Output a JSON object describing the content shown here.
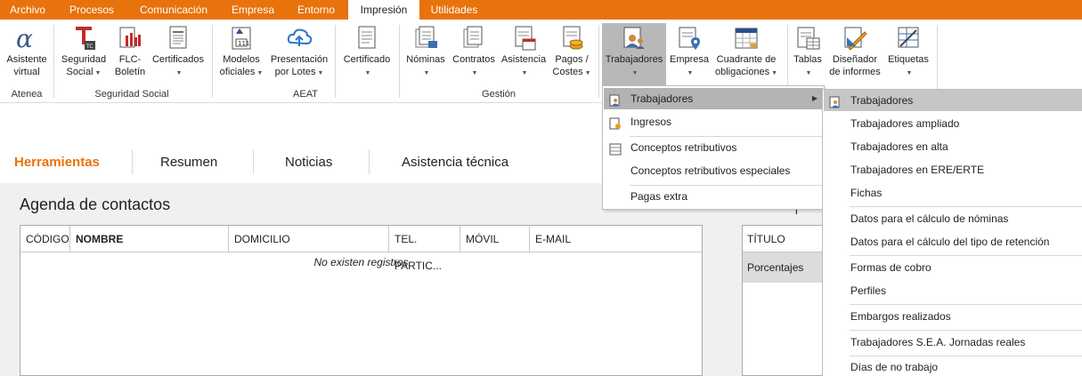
{
  "menu_tabs": [
    "Archivo",
    "Procesos",
    "Comunicación",
    "Empresa",
    "Entorno",
    "Impresión",
    "Utilidades"
  ],
  "active_tab": "Impresión",
  "ribbon": {
    "asistente": {
      "line1": "Asistente",
      "line2": "virtual"
    },
    "seguridad_social": {
      "line1": "Seguridad",
      "line2": "Social"
    },
    "flc": {
      "line1": "FLC-",
      "line2": "Boletín"
    },
    "certificados": {
      "line1": "Certificados"
    },
    "modelos": {
      "line1": "Modelos",
      "line2": "oficiales"
    },
    "presentacion": {
      "line1": "Presentación",
      "line2": "por Lotes"
    },
    "certificado": {
      "line1": "Certificado"
    },
    "nominas": {
      "line1": "Nóminas"
    },
    "contratos": {
      "line1": "Contratos"
    },
    "asistencia": {
      "line1": "Asistencia"
    },
    "pagos": {
      "line1": "Pagos /",
      "line2": "Costes"
    },
    "trabajadores": {
      "line1": "Trabajadores"
    },
    "empresa": {
      "line1": "Empresa"
    },
    "cuadrante": {
      "line1": "Cuadrante de",
      "line2": "obligaciones"
    },
    "tablas": {
      "line1": "Tablas"
    },
    "disenador": {
      "line1": "Diseñador",
      "line2": "de informes"
    },
    "etiquetas": {
      "line1": "Etiquetas"
    },
    "groups": {
      "atenea": "Atenea",
      "seguridad_social": "Seguridad Social",
      "aeat": "AEAT",
      "gestion": "Gestión"
    }
  },
  "subtabs": [
    "Herramientas",
    "Resumen",
    "Noticias",
    "Asistencia técnica"
  ],
  "agenda": {
    "title": "Agenda de contactos",
    "columns": [
      "CÓDIGO",
      "NOMBRE",
      "DOMICILIO",
      "TEL. PARTIC...",
      "MÓVIL",
      "E-MAIL"
    ],
    "empty_text": "No existen registros"
  },
  "side_table": {
    "header": "TÍTULO",
    "row": "Porcentajes",
    "partial_text": "r"
  },
  "dropdown": {
    "items": [
      "Trabajadores",
      "Ingresos",
      "Conceptos retributivos",
      "Conceptos retributivos especiales",
      "Pagas extra"
    ]
  },
  "submenu": {
    "items": [
      "Trabajadores",
      "Trabajadores ampliado",
      "Trabajadores en alta",
      "Trabajadores en ERE/ERTE",
      "Fichas",
      "Datos para el cálculo de nóminas",
      "Datos para el cálculo del tipo de retención",
      "Formas de cobro",
      "Perfiles",
      "Embargos realizados",
      "Trabajadores S.E.A. Jornadas reales",
      "Días de no trabajo"
    ]
  },
  "colors": {
    "accent": "#e8720c",
    "highlight": "#b3b3b3"
  }
}
